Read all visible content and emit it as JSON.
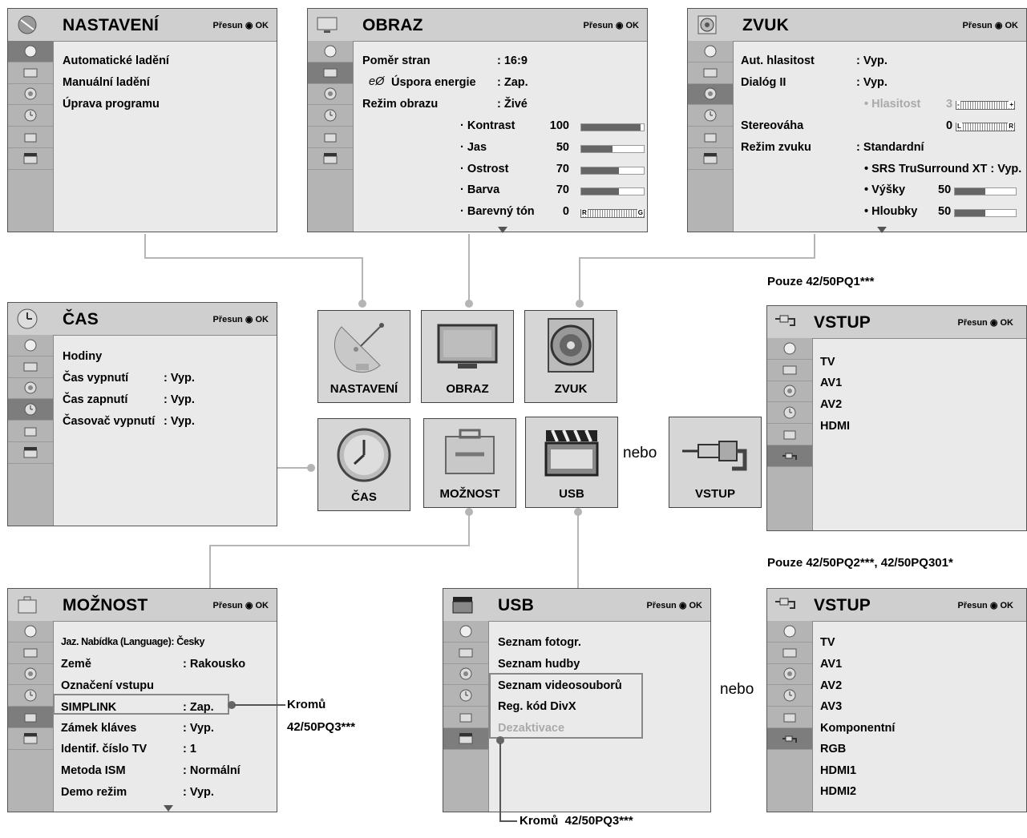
{
  "common": {
    "nav_hint": "Přesun ◉ OK",
    "more_arrow": "▼"
  },
  "nastaveni": {
    "title": "NASTAVENÍ",
    "items": [
      "Automatické ladění",
      "Manuální ladění",
      "Úprava programu"
    ]
  },
  "obraz": {
    "title": "OBRAZ",
    "rows": [
      {
        "label": "Poměr stran",
        "value": ": 16:9"
      },
      {
        "label": "Úspora energie",
        "value": ": Zap."
      },
      {
        "label": "Režim obrazu",
        "value": ": Živé"
      }
    ],
    "sliders": [
      {
        "label": "· Kontrast",
        "value": "100",
        "level": 0.95
      },
      {
        "label": "· Jas",
        "value": "50",
        "level": 0.5
      },
      {
        "label": "· Ostrost",
        "value": "70",
        "level": 0.6
      },
      {
        "label": "· Barva",
        "value": "70",
        "level": 0.6
      }
    ],
    "tint": {
      "label": "· Barevný tón",
      "value": "0",
      "left": "R",
      "right": "G"
    }
  },
  "zvuk": {
    "title": "ZVUK",
    "rows": [
      {
        "label": "Aut. hlasitost",
        "value": ": Vyp."
      },
      {
        "label": "Dialóg II",
        "value": ": Vyp."
      }
    ],
    "hlasitost": {
      "label": "• Hlasitost",
      "value": "3",
      "minus": "-",
      "plus": "+"
    },
    "stereovaha": {
      "label": "Stereováha",
      "value": "0",
      "left": "L",
      "right": "R"
    },
    "rezim": {
      "label": "Režim zvuku",
      "value": ": Standardní"
    },
    "srs": "• SRS TruSurround XT : Vyp.",
    "sub": [
      {
        "label": "• Výšky",
        "value": "50",
        "level": 0.5
      },
      {
        "label": "• Hloubky",
        "value": "50",
        "level": 0.5
      }
    ]
  },
  "cas": {
    "title": "ČAS",
    "rows": [
      {
        "label": "Hodiny",
        "value": ""
      },
      {
        "label": "Čas vypnutí",
        "value": ": Vyp."
      },
      {
        "label": "Čas zapnutí",
        "value": ": Vyp."
      },
      {
        "label": "Časovač vypnutí",
        "value": ": Vyp."
      }
    ]
  },
  "moznost": {
    "title": "MOŽNOST",
    "language": "Jaz. Nabídka (Language): Česky",
    "rows": [
      {
        "label": "Země",
        "value": ": Rakousko"
      },
      {
        "label": "Označení vstupu",
        "value": ""
      },
      {
        "label": "SIMPLINK",
        "value": ": Zap."
      },
      {
        "label": "Zámek kláves",
        "value": ": Vyp."
      },
      {
        "label": "Identif. číslo TV",
        "value": ": 1"
      },
      {
        "label": "Metoda ISM",
        "value": ": Normální"
      },
      {
        "label": "Demo režim",
        "value": ": Vyp."
      }
    ]
  },
  "usb": {
    "title": "USB",
    "items": [
      "Seznam fotogr.",
      "Seznam hudby",
      "Seznam videosouborů",
      "Reg. kód DivX",
      "Dezaktivace"
    ]
  },
  "vstup1": {
    "title": "VSTUP",
    "caption": "Pouze 42/50PQ1***",
    "items": [
      "TV",
      "AV1",
      "AV2",
      "HDMI"
    ]
  },
  "vstup2": {
    "title": "VSTUP",
    "caption": "Pouze 42/50PQ2***, 42/50PQ301*",
    "items": [
      "TV",
      "AV1",
      "AV2",
      "AV3",
      "Komponentní",
      "RGB",
      "HDMI1",
      "HDMI2"
    ]
  },
  "hub": {
    "nastaveni": "NASTAVENÍ",
    "obraz": "OBRAZ",
    "zvuk": "ZVUK",
    "cas": "ČAS",
    "moznost": "MOŽNOST",
    "usb": "USB",
    "vstup": "VSTUP"
  },
  "labels": {
    "nebo": "nebo",
    "kromu_simplink_1": "Kromů",
    "kromu_simplink_2": "42/50PQ3***",
    "kromu_usb": "Kromů  42/50PQ3***"
  }
}
